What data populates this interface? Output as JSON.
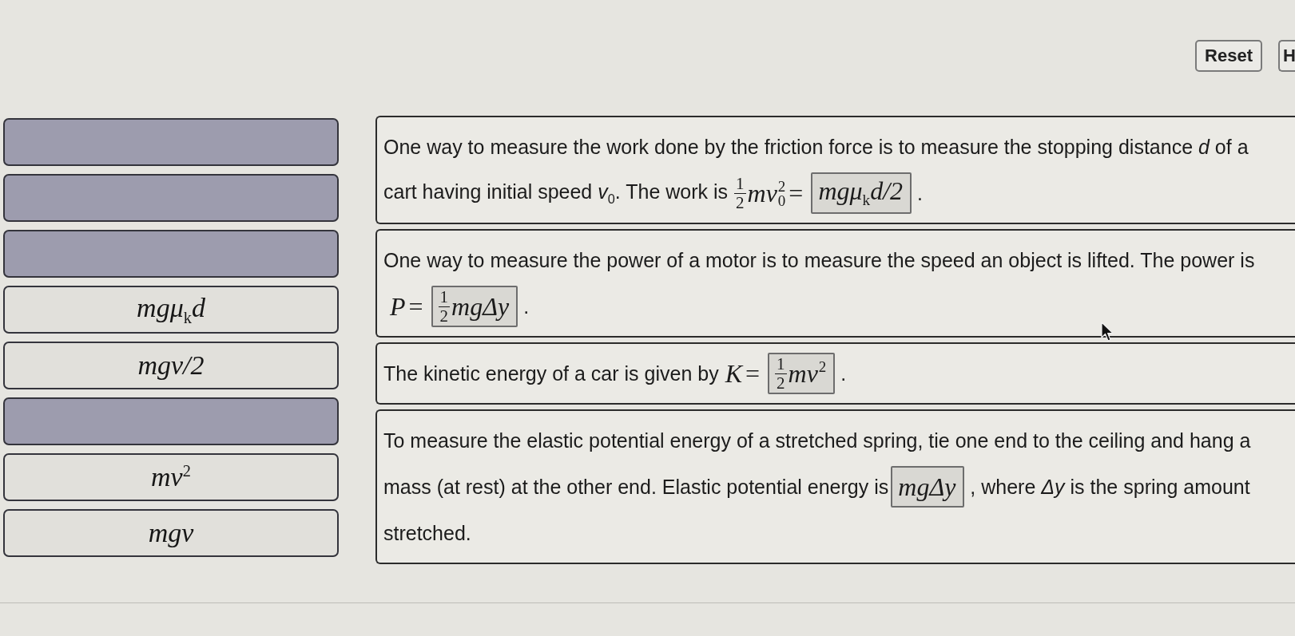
{
  "toolbar": {
    "buttons": [
      "Reset",
      "H"
    ]
  },
  "answer_bank": [
    {
      "placed": true
    },
    {
      "placed": true
    },
    {
      "placed": true
    },
    {
      "label": "mgμ$_{k}$d",
      "placed": false
    },
    {
      "label": "mgv/2",
      "placed": false
    },
    {
      "placed": true
    },
    {
      "label": "mv$^{2}$",
      "placed": false
    },
    {
      "label": "mgv",
      "placed": false
    }
  ],
  "statements": [
    {
      "lines": [
        [
          {
            "kind": "text",
            "text": "One way to measure the work done by the friction force is to measure the stopping distance *d* of a"
          }
        ],
        [
          {
            "kind": "text",
            "text": "cart having initial speed *v*$_{0}$. The work is"
          },
          {
            "kind": "formula",
            "items": [
              {
                "kind": "frac",
                "num": "1",
                "den": "2"
              },
              {
                "kind": "var",
                "text": "mv",
                "sub": "0",
                "sup": "2"
              },
              {
                "kind": "op",
                "text": "="
              }
            ]
          },
          {
            "kind": "blank",
            "items": [
              {
                "kind": "var",
                "text": "mgμ$_{k}$d/2"
              }
            ]
          },
          {
            "kind": "text",
            "text": "."
          }
        ]
      ]
    },
    {
      "lines": [
        [
          {
            "kind": "text",
            "text": "One way to measure the power of a motor is to measure the speed an object is lifted. The power is"
          }
        ],
        [
          {
            "kind": "formula",
            "items": [
              {
                "kind": "var",
                "text": "P"
              },
              {
                "kind": "op",
                "text": "="
              }
            ]
          },
          {
            "kind": "blank",
            "items": [
              {
                "kind": "frac",
                "num": "1",
                "den": "2"
              },
              {
                "kind": "var",
                "text": "mgΔy"
              }
            ]
          },
          {
            "kind": "text",
            "text": "."
          }
        ]
      ]
    },
    {
      "lines": [
        [
          {
            "kind": "text",
            "text": "The kinetic energy of a car is given by"
          },
          {
            "kind": "formula",
            "items": [
              {
                "kind": "var",
                "text": "K"
              },
              {
                "kind": "op",
                "text": "="
              }
            ]
          },
          {
            "kind": "blank",
            "items": [
              {
                "kind": "frac",
                "num": "1",
                "den": "2"
              },
              {
                "kind": "var",
                "text": "mv",
                "sup": "2"
              }
            ]
          },
          {
            "kind": "text",
            "text": "."
          }
        ]
      ]
    },
    {
      "lines": [
        [
          {
            "kind": "text",
            "text": "To measure the elastic potential energy of a stretched spring, tie one end to the ceiling and hang a"
          }
        ],
        [
          {
            "kind": "text",
            "text": "mass (at rest) at the other end. Elastic potential energy is"
          },
          {
            "kind": "blank",
            "items": [
              {
                "kind": "var",
                "text": "mgΔy"
              }
            ]
          },
          {
            "kind": "text",
            "text": ", where *Δy* is the spring amount"
          }
        ],
        [
          {
            "kind": "text",
            "text": "stretched."
          }
        ]
      ]
    }
  ]
}
